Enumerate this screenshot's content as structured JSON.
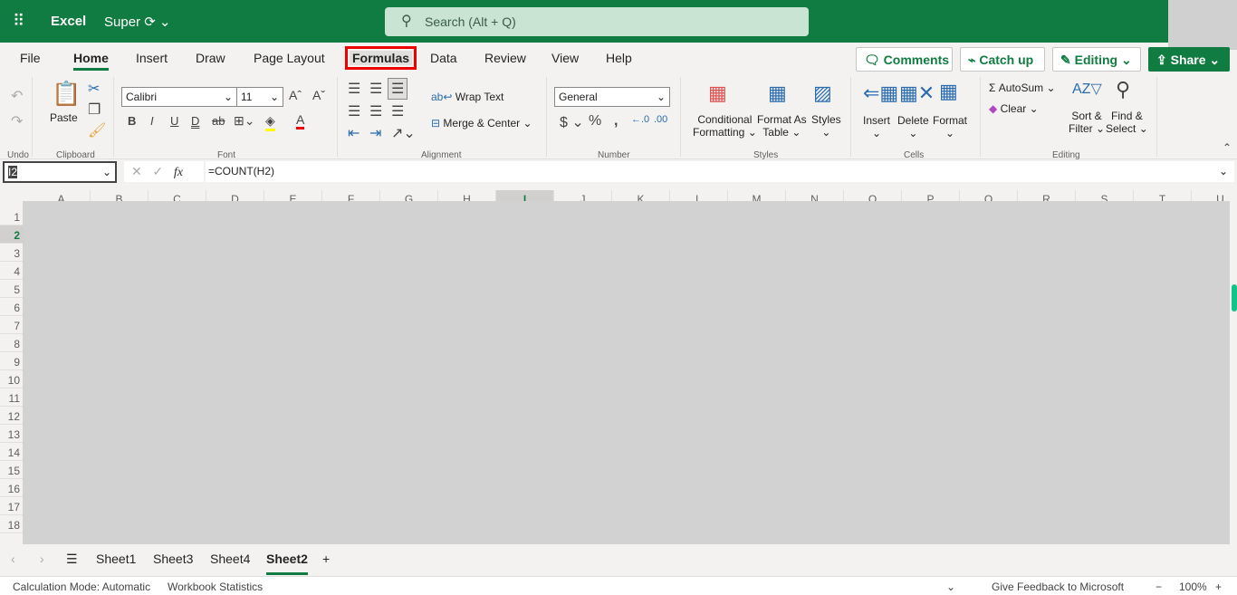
{
  "app": {
    "name": "Excel",
    "doc": "Super",
    "search_placeholder": "Search (Alt + Q)"
  },
  "colors": {
    "brand": "#107c41",
    "highlight": "#e00000"
  },
  "tabs": [
    "File",
    "Home",
    "Insert",
    "Draw",
    "Page Layout",
    "Formulas",
    "Data",
    "Review",
    "View",
    "Help"
  ],
  "header_buttons": {
    "comments": "Comments",
    "catchup": "Catch up",
    "editing": "Editing",
    "share": "Share"
  },
  "ribbon": {
    "undo_group": "Undo",
    "clipboard_group": "Clipboard",
    "paste": "Paste",
    "font_group": "Font",
    "font_name": "Calibri",
    "font_size": "11",
    "alignment_group": "Alignment",
    "wrap_text": "Wrap Text",
    "merge_center": "Merge & Center",
    "number_group": "Number",
    "number_format": "General",
    "styles_group": "Styles",
    "conditional": "Conditional",
    "formatting": "Formatting",
    "format_as": "Format As",
    "table": "Table",
    "styles": "Styles",
    "cells_group": "Cells",
    "insert": "Insert",
    "delete": "Delete",
    "format": "Format",
    "editing_group": "Editing",
    "autosum": "AutoSum",
    "clear": "Clear",
    "sort": "Sort &",
    "filter": "Filter",
    "find": "Find &",
    "select": "Select"
  },
  "formula_bar": {
    "name_box": "I2",
    "formula": "=COUNT(H2)"
  },
  "columns": [
    "A",
    "B",
    "C",
    "D",
    "E",
    "F",
    "G",
    "H",
    "I",
    "J",
    "K",
    "L",
    "M",
    "N",
    "O",
    "P",
    "Q",
    "R",
    "S",
    "T",
    "U"
  ],
  "selected_column": "I",
  "rows": [
    "1",
    "2",
    "3",
    "4",
    "5",
    "6",
    "7",
    "8",
    "9",
    "10",
    "11",
    "12",
    "13",
    "14",
    "15",
    "16",
    "17",
    "18"
  ],
  "selected_row": "2",
  "sheets": [
    "Sheet1",
    "Sheet3",
    "Sheet4",
    "Sheet2"
  ],
  "active_sheet": "Sheet2",
  "status": {
    "calc_mode": "Calculation Mode: Automatic",
    "stats": "Workbook Statistics",
    "feedback": "Give Feedback to Microsoft",
    "zoom": "100%"
  }
}
